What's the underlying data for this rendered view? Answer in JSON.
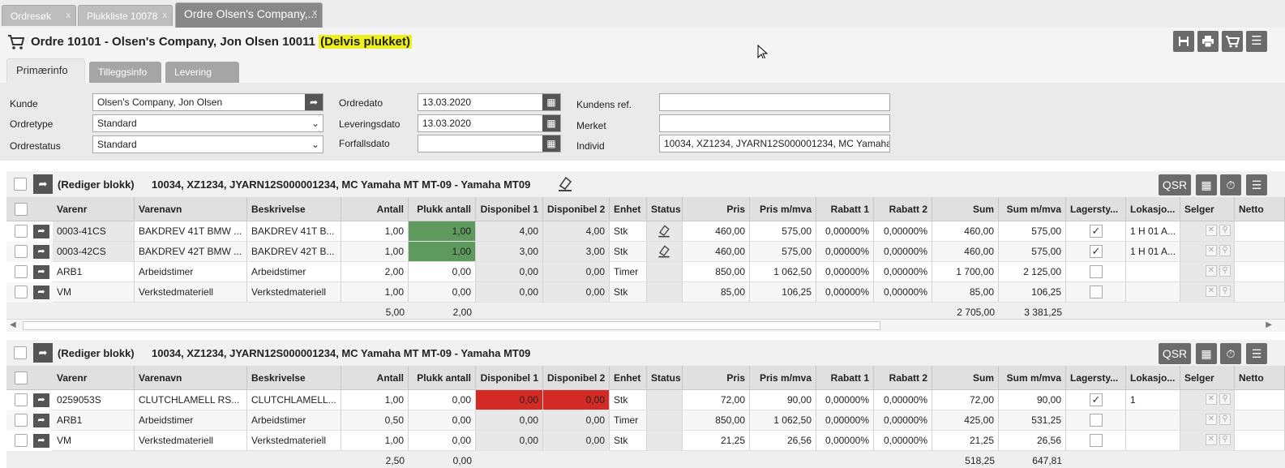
{
  "tabs": [
    {
      "label": "Ordresøk",
      "close": "x"
    },
    {
      "label": "Plukkliste 10078",
      "close": "x"
    },
    {
      "label": "Ordre Olsen's Company,...",
      "close": "x"
    }
  ],
  "header": {
    "title": "Ordre 10101 - Olsen's Company, Jon Olsen 10011",
    "status": "(Delvis plukket)"
  },
  "section_tabs": [
    "Primærinfo",
    "Tilleggsinfo",
    "Levering"
  ],
  "form": {
    "kunde_label": "Kunde",
    "kunde_value": "Olsen's Company, Jon Olsen",
    "ordretype_label": "Ordretype",
    "ordretype_value": "Standard",
    "ordrestatus_label": "Ordrestatus",
    "ordrestatus_value": "Standard",
    "ordredato_label": "Ordredato",
    "ordredato_value": "13.03.2020",
    "leveringsdato_label": "Leveringsdato",
    "leveringsdato_value": "13.03.2020",
    "forfallsdato_label": "Forfallsdato",
    "forfallsdato_value": "",
    "kundens_ref_label": "Kundens ref.",
    "kundens_ref_value": "",
    "merket_label": "Merket",
    "merket_value": "",
    "individ_label": "Individ",
    "individ_value": "10034, XZ1234, JYARN12S000001234, MC Yamaha MT MT-09 - Yamaha MT09"
  },
  "columns": [
    "Varenr",
    "Varenavn",
    "Beskrivelse",
    "Antall",
    "Plukk antall",
    "Disponibel 1",
    "Disponibel 2",
    "Enhet",
    "Status",
    "Pris",
    "Pris m/mva",
    "Rabatt 1",
    "Rabatt 2",
    "Sum",
    "Sum m/mva",
    "Lagersty...",
    "Lokasjo...",
    "Selger",
    "Netto"
  ],
  "blocks": [
    {
      "edit_label": "(Rediger blokk)",
      "title": "10034, XZ1234, JYARN12S000001234, MC Yamaha MT MT-09 - Yamaha MT09",
      "qsr_label": "QSR",
      "rows": [
        {
          "varenr": "0003-41CS",
          "varenavn": "BAKDREV 41T BMW ...",
          "beskrivelse": "BAKDREV 41T B...",
          "antall": "1,00",
          "plukk": "1,00",
          "disp1": "4,00",
          "disp2": "4,00",
          "enhet": "Stk",
          "status_icon": "eraser-icon",
          "pris": "460,00",
          "pris_mva": "575,00",
          "rabatt1": "0,00000%",
          "rabatt2": "0,00000%",
          "sum": "460,00",
          "sum_mva": "575,00",
          "lager": true,
          "lokasjon": "1 H 01 A...",
          "plukk_color": "green",
          "disp_color": ""
        },
        {
          "varenr": "0003-42CS",
          "varenavn": "BAKDREV 42T BMW ...",
          "beskrivelse": "BAKDREV 42T B...",
          "antall": "1,00",
          "plukk": "1,00",
          "disp1": "3,00",
          "disp2": "3,00",
          "enhet": "Stk",
          "status_icon": "eraser-icon",
          "pris": "460,00",
          "pris_mva": "575,00",
          "rabatt1": "0,00000%",
          "rabatt2": "0,00000%",
          "sum": "460,00",
          "sum_mva": "575,00",
          "lager": true,
          "lokasjon": "1 H 01 A...",
          "plukk_color": "green",
          "disp_color": ""
        },
        {
          "varenr": "ARB1",
          "varenavn": "Arbeidstimer",
          "beskrivelse": "Arbeidstimer",
          "antall": "2,00",
          "plukk": "0,00",
          "disp1": "0,00",
          "disp2": "0,00",
          "enhet": "Timer",
          "status_icon": "",
          "pris": "850,00",
          "pris_mva": "1 062,50",
          "rabatt1": "0,00000%",
          "rabatt2": "0,00000%",
          "sum": "1 700,00",
          "sum_mva": "2 125,00",
          "lager": false,
          "lokasjon": "",
          "plukk_color": "",
          "disp_color": ""
        },
        {
          "varenr": "VM",
          "varenavn": "Verkstedmateriell",
          "beskrivelse": "Verkstedmateriell",
          "antall": "1,00",
          "plukk": "0,00",
          "disp1": "0,00",
          "disp2": "0,00",
          "enhet": "Stk",
          "status_icon": "",
          "pris": "85,00",
          "pris_mva": "106,25",
          "rabatt1": "0,00000%",
          "rabatt2": "0,00000%",
          "sum": "85,00",
          "sum_mva": "106,25",
          "lager": false,
          "lokasjon": "",
          "plukk_color": "",
          "disp_color": ""
        }
      ],
      "totals": {
        "antall": "5,00",
        "plukk": "2,00",
        "sum": "2 705,00",
        "sum_mva": "3 381,25"
      }
    },
    {
      "edit_label": "(Rediger blokk)",
      "title": "10034, XZ1234, JYARN12S000001234, MC Yamaha MT MT-09 - Yamaha MT09",
      "qsr_label": "QSR",
      "rows": [
        {
          "varenr": "0259053S",
          "varenavn": "CLUTCHLAMELL RS...",
          "beskrivelse": "CLUTCHLAMELL...",
          "antall": "1,00",
          "plukk": "0,00",
          "disp1": "0,00",
          "disp2": "0,00",
          "enhet": "Stk",
          "status_icon": "",
          "pris": "72,00",
          "pris_mva": "90,00",
          "rabatt1": "0,00000%",
          "rabatt2": "0,00000%",
          "sum": "72,00",
          "sum_mva": "90,00",
          "lager": true,
          "lokasjon": "1",
          "plukk_color": "",
          "disp_color": "red"
        },
        {
          "varenr": "ARB1",
          "varenavn": "Arbeidstimer",
          "beskrivelse": "Arbeidstimer",
          "antall": "0,50",
          "plukk": "0,00",
          "disp1": "0,00",
          "disp2": "0,00",
          "enhet": "Timer",
          "status_icon": "",
          "pris": "850,00",
          "pris_mva": "1 062,50",
          "rabatt1": "0,00000%",
          "rabatt2": "0,00000%",
          "sum": "425,00",
          "sum_mva": "531,25",
          "lager": false,
          "lokasjon": "",
          "plukk_color": "",
          "disp_color": ""
        },
        {
          "varenr": "VM",
          "varenavn": "Verkstedmateriell",
          "beskrivelse": "Verkstedmateriell",
          "antall": "1,00",
          "plukk": "0,00",
          "disp1": "0,00",
          "disp2": "0,00",
          "enhet": "Stk",
          "status_icon": "",
          "pris": "21,25",
          "pris_mva": "26,56",
          "rabatt1": "0,00000%",
          "rabatt2": "0,00000%",
          "sum": "21,25",
          "sum_mva": "26,56",
          "lager": false,
          "lokasjon": "",
          "plukk_color": "",
          "disp_color": ""
        }
      ],
      "totals": {
        "antall": "2,50",
        "plukk": "0,00",
        "sum": "518,25",
        "sum_mva": "647,81"
      }
    }
  ],
  "colors": {
    "green": "#5e9a5e",
    "red": "#d42a26",
    "highlight": "#eef01e",
    "button": "#6b6b6b"
  }
}
